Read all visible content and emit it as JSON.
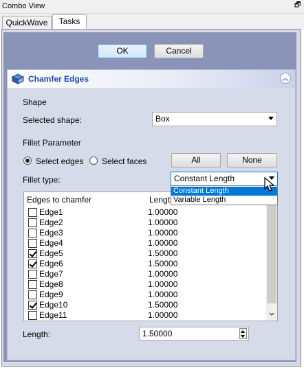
{
  "window": {
    "title": "Combo View",
    "undock_glyph": "🗗"
  },
  "tabs": [
    {
      "label": "QuickWave"
    },
    {
      "label": "Tasks"
    }
  ],
  "dialog": {
    "ok_label": "OK",
    "cancel_label": "Cancel"
  },
  "panel": {
    "title": "Chamfer Edges",
    "collapse_glyph": "︽",
    "shape_section": "Shape",
    "selected_shape_label": "Selected shape:",
    "selected_shape_value": "Box",
    "fillet_section": "Fillet Parameter",
    "radio_edges": "Select edges",
    "radio_faces": "Select faces",
    "all_label": "All",
    "none_label": "None",
    "fillet_type_label": "Fillet type:",
    "fillet_type_value": "Constant Length",
    "fillet_type_options": [
      "Constant Length",
      "Variable Length"
    ],
    "table": {
      "col_edges": "Edges to chamfer",
      "col_length": "Length",
      "rows": [
        {
          "edge": "Edge1",
          "length": "1.00000",
          "checked": false
        },
        {
          "edge": "Edge2",
          "length": "1.00000",
          "checked": false
        },
        {
          "edge": "Edge3",
          "length": "1.00000",
          "checked": false
        },
        {
          "edge": "Edge4",
          "length": "1.00000",
          "checked": false
        },
        {
          "edge": "Edge5",
          "length": "1.50000",
          "checked": true
        },
        {
          "edge": "Edge6",
          "length": "1.50000",
          "checked": true
        },
        {
          "edge": "Edge7",
          "length": "1.00000",
          "checked": false
        },
        {
          "edge": "Edge8",
          "length": "1.00000",
          "checked": false
        },
        {
          "edge": "Edge9",
          "length": "1.00000",
          "checked": false
        },
        {
          "edge": "Edge10",
          "length": "1.50000",
          "checked": true
        },
        {
          "edge": "Edge11",
          "length": "1.00000",
          "checked": false
        }
      ]
    },
    "length_label": "Length:",
    "length_value": "1.50000"
  },
  "colors": {
    "accent": "#0078d7",
    "panel_title": "#1a4aa4"
  }
}
